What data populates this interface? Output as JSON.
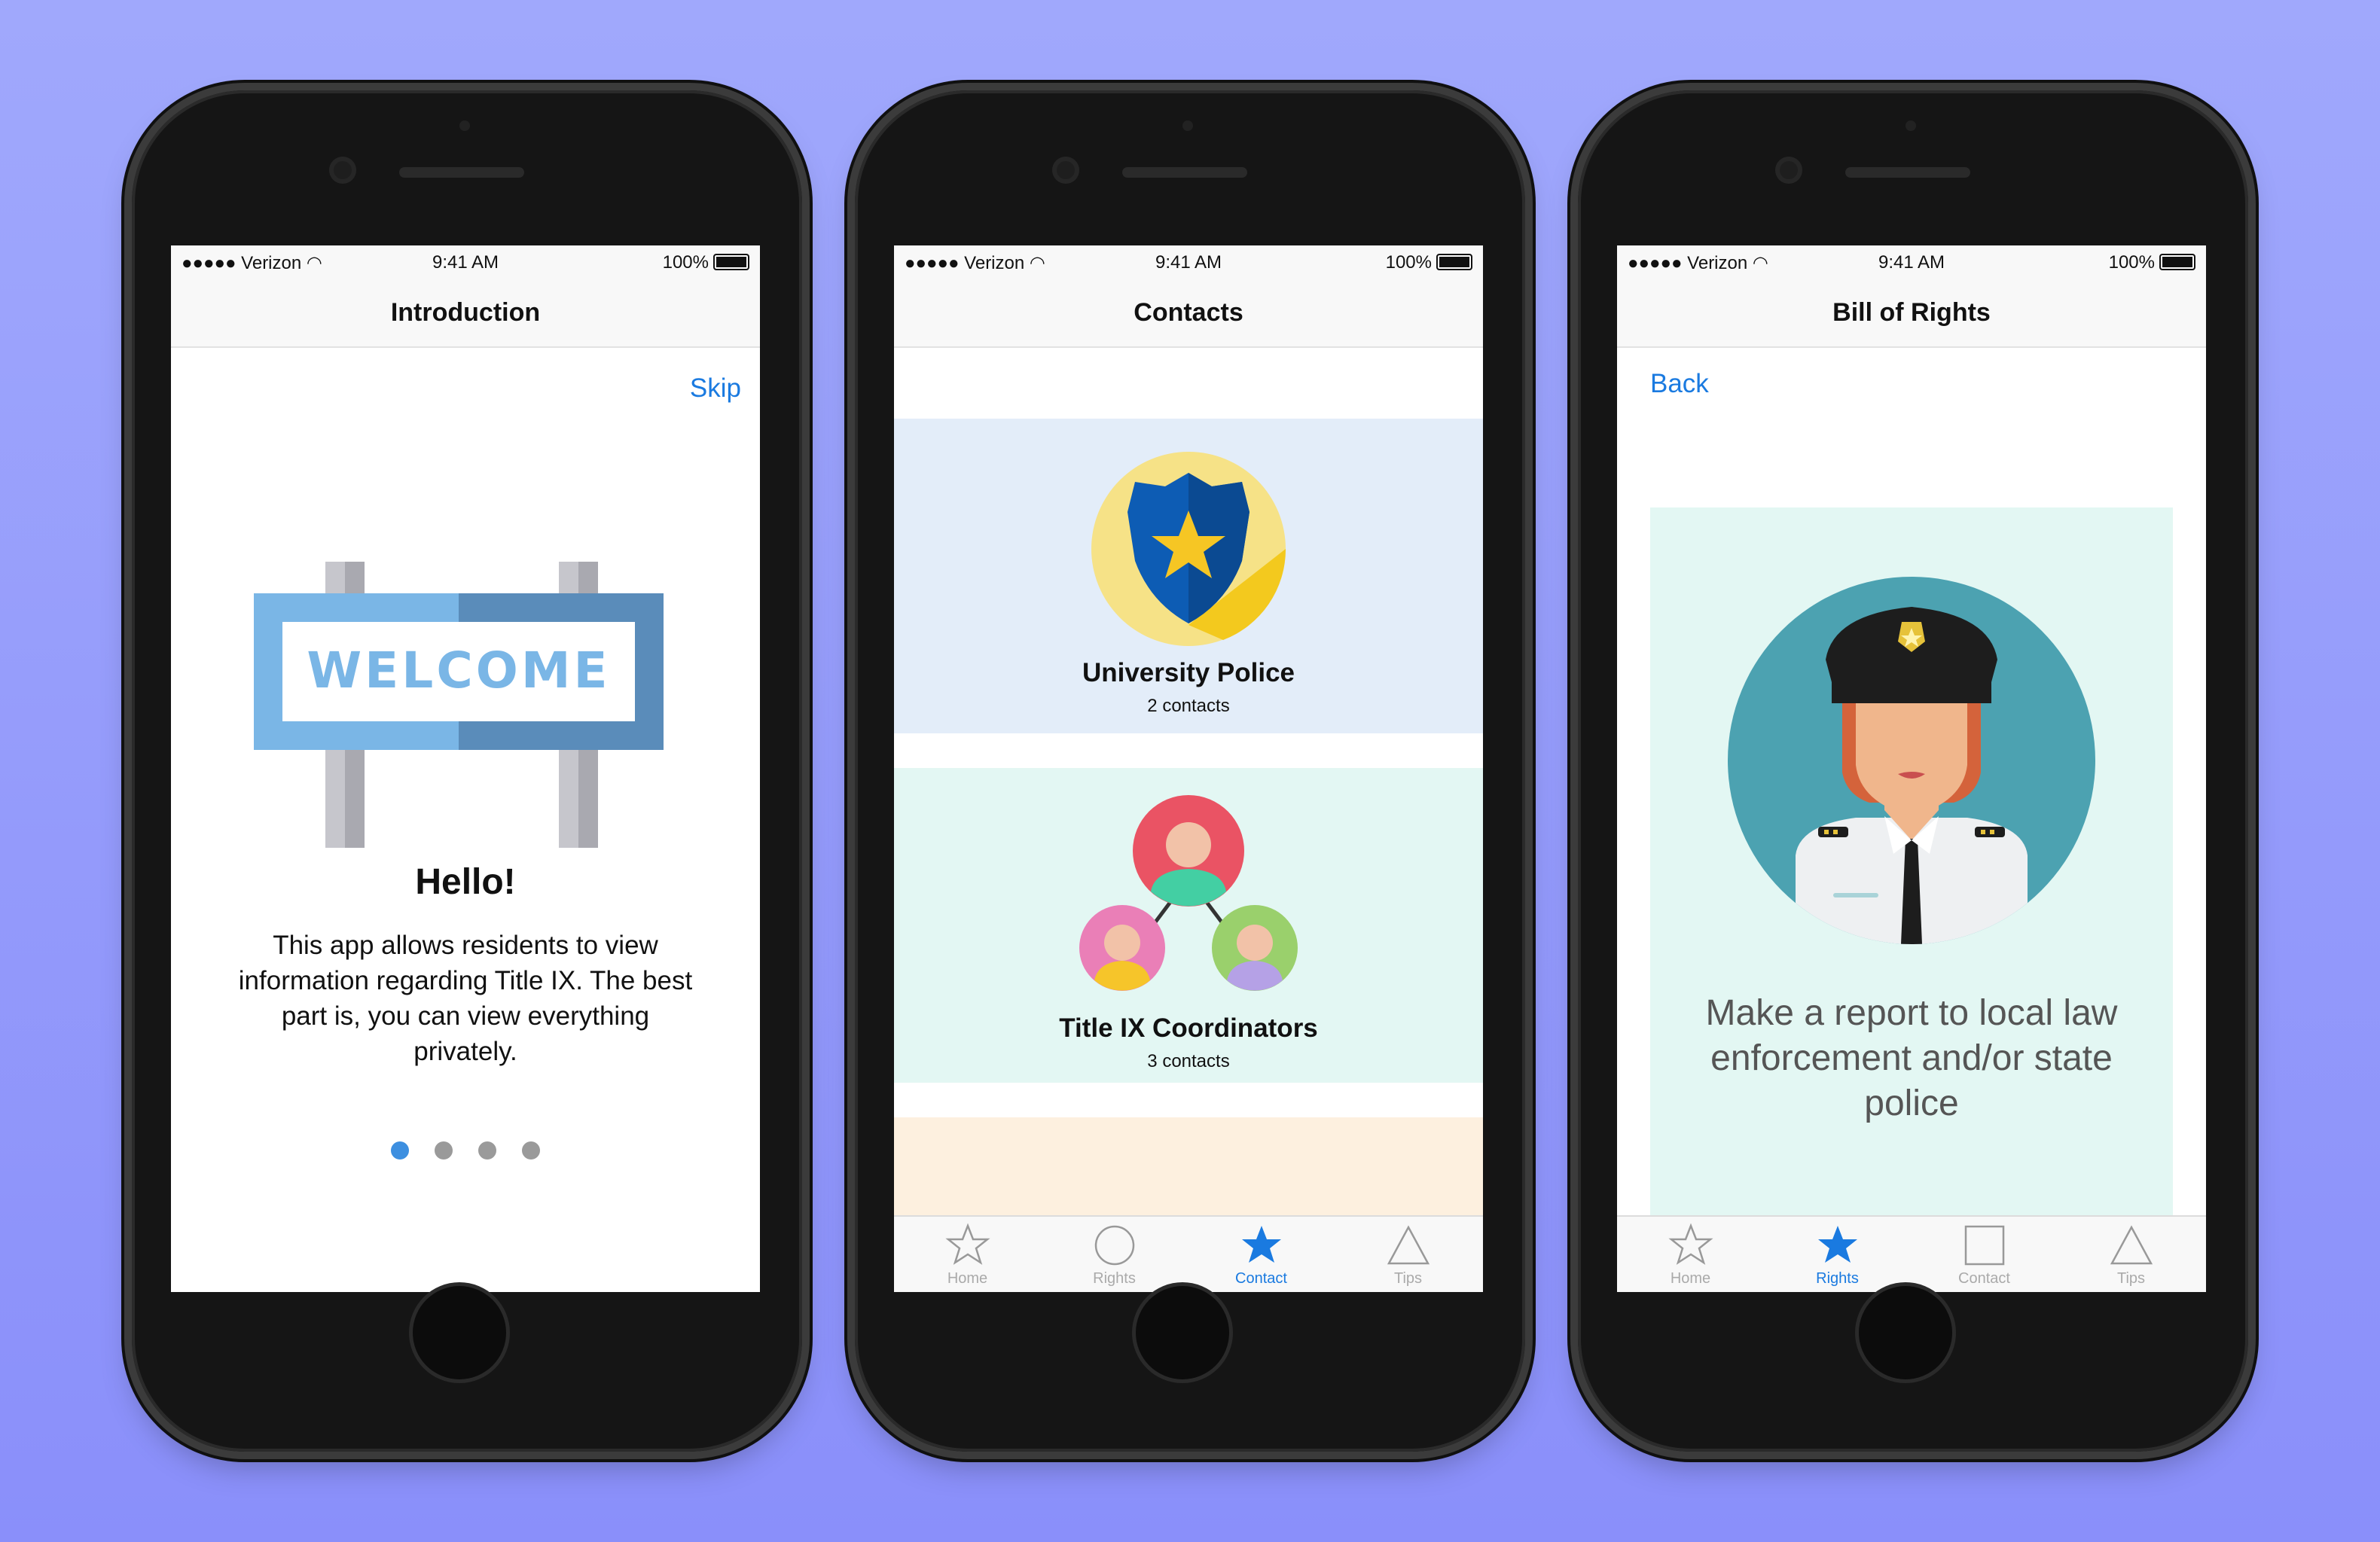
{
  "status": {
    "carrier": "Verizon",
    "time": "9:41 AM",
    "battery": "100%"
  },
  "screen1": {
    "title": "Introduction",
    "skip": "Skip",
    "sign_text": "WELCOME",
    "heading": "Hello!",
    "body": "This app allows residents to view information regarding Title IX. The best part is, you can view everything privately.",
    "page_dots": {
      "count": 4,
      "active": 1
    }
  },
  "screen2": {
    "title": "Contacts",
    "cards": [
      {
        "name": "University Police",
        "count": "2 contacts",
        "bg": "#e3edf9"
      },
      {
        "name": "Title IX Coordinators",
        "count": "3 contacts",
        "bg": "#e3f7f3"
      },
      {
        "bg": "#fdf0df"
      }
    ],
    "tabs": [
      {
        "label": "Home",
        "icon": "star-outline-icon"
      },
      {
        "label": "Rights",
        "icon": "circle-outline-icon"
      },
      {
        "label": "Contact",
        "icon": "star-filled-icon",
        "active": true
      },
      {
        "label": "Tips",
        "icon": "triangle-outline-icon"
      }
    ]
  },
  "screen3": {
    "title": "Bill of Rights",
    "back": "Back",
    "caption": "Make a report to local law enforcement and/or state police",
    "card_bg": "#e3f7f3",
    "tabs": [
      {
        "label": "Home",
        "icon": "star-outline-icon"
      },
      {
        "label": "Rights",
        "icon": "star-filled-icon",
        "active": true
      },
      {
        "label": "Contact",
        "icon": "square-outline-icon"
      },
      {
        "label": "Tips",
        "icon": "triangle-outline-icon"
      }
    ]
  },
  "colors": {
    "accent": "#1a7ae0",
    "background": "#9499fb"
  }
}
